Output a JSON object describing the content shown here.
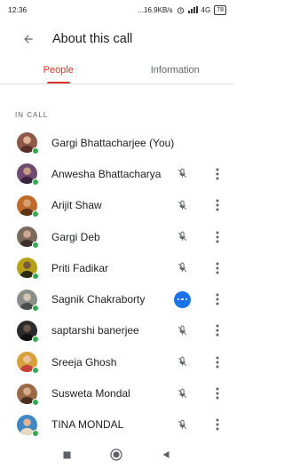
{
  "status_bar": {
    "time": "12:36",
    "network_speed": "...16.9KB/s",
    "network_type": "4G",
    "battery": "78"
  },
  "header": {
    "back_icon": "arrow-back-icon",
    "title": "About this call"
  },
  "tabs": [
    {
      "label": "People",
      "active": true
    },
    {
      "label": "Information",
      "active": false
    }
  ],
  "section": {
    "label": "IN CALL"
  },
  "participants": [
    {
      "name": "Gargi Bhattacharjee (You)",
      "mic": "none",
      "menu": false,
      "avatar_color": "#8d5a4a"
    },
    {
      "name": "Anwesha Bhattacharya",
      "mic": "muted",
      "menu": true,
      "avatar_color": "#6d4c6f"
    },
    {
      "name": "Arijit Shaw",
      "mic": "muted",
      "menu": true,
      "avatar_color": "#c06a2b"
    },
    {
      "name": "Gargi Deb",
      "mic": "muted",
      "menu": true,
      "avatar_color": "#7a6a5e"
    },
    {
      "name": "Priti Fadikar",
      "mic": "muted",
      "menu": true,
      "avatar_color": "#b5a21a"
    },
    {
      "name": "Sagnik Chakraborty",
      "mic": "talking",
      "menu": true,
      "avatar_color": "#8a8f8a"
    },
    {
      "name": "saptarshi banerjee",
      "mic": "muted",
      "menu": true,
      "avatar_color": "#2b2b2b"
    },
    {
      "name": "Sreeja Ghosh",
      "mic": "muted",
      "menu": true,
      "avatar_color": "#d8a03a"
    },
    {
      "name": "Susweta Mondal",
      "mic": "muted",
      "menu": true,
      "avatar_color": "#9a6b4a"
    },
    {
      "name": "TINA MONDAL",
      "mic": "muted",
      "menu": true,
      "avatar_color": "#3f88c5"
    }
  ],
  "colors": {
    "accent": "#d93025",
    "presence": "#34a853",
    "talking": "#1a73e8"
  },
  "nav_bar": {
    "recents_icon": "square-recents-icon",
    "home_icon": "circle-home-icon",
    "back_icon": "triangle-back-icon"
  }
}
